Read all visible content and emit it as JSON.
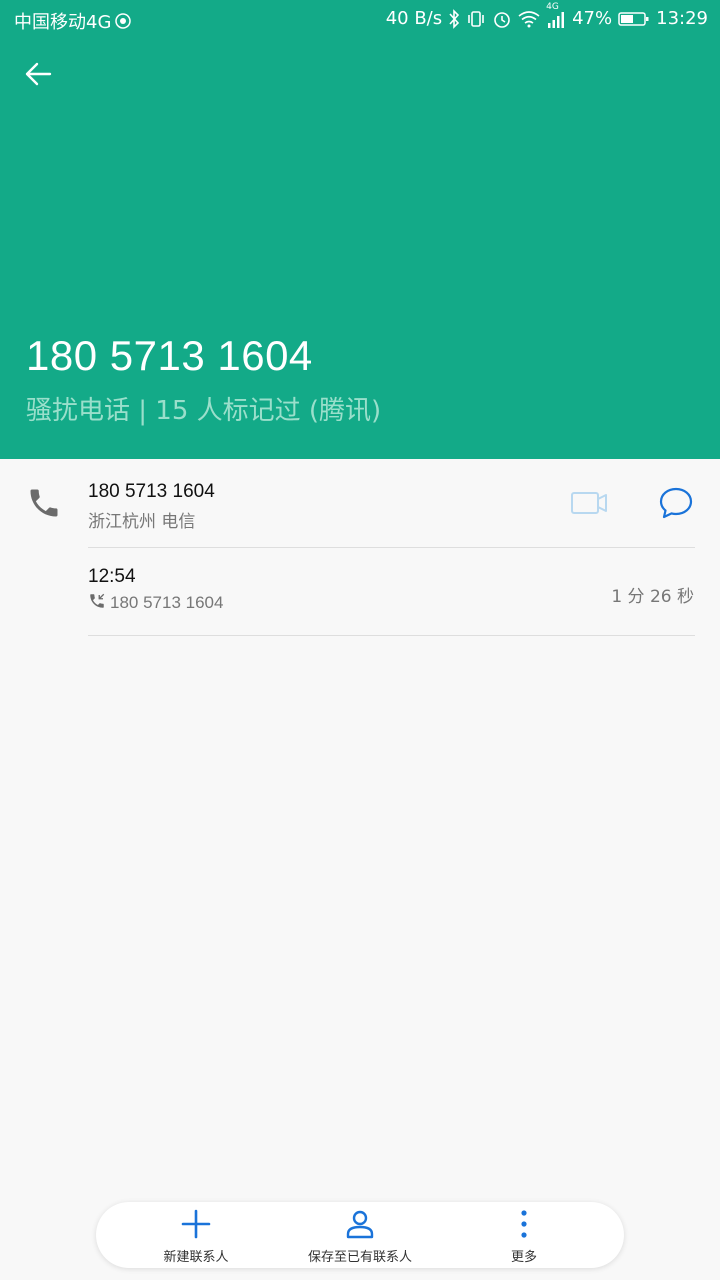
{
  "status_bar": {
    "carrier": "中国移动4G",
    "net_speed": "40 B/s",
    "network_badge": "4G",
    "battery": "47%",
    "time": "13:29",
    "icons": [
      "sim-badge-icon",
      "bluetooth-icon",
      "vibrate-icon",
      "alarm-icon",
      "wifi-icon",
      "signal-icon",
      "battery-icon"
    ]
  },
  "header": {
    "background": "#13aa88",
    "number": "180 5713 1604",
    "tag": "骚扰电话 | 15 人标记过 (腾讯)"
  },
  "contact_row": {
    "number": "180 5713 1604",
    "location": "浙江杭州 电信",
    "icons": [
      "phone-icon",
      "video-call-icon",
      "message-icon"
    ]
  },
  "call_log": {
    "time": "12:54",
    "number": "180 5713 1604",
    "duration": "1 分 26 秒",
    "icon": "incoming-call-icon"
  },
  "bottom_bar": {
    "new_contact": "新建联系人",
    "save_existing": "保存至已有联系人",
    "more": "更多",
    "accent": "#1a73d9"
  }
}
